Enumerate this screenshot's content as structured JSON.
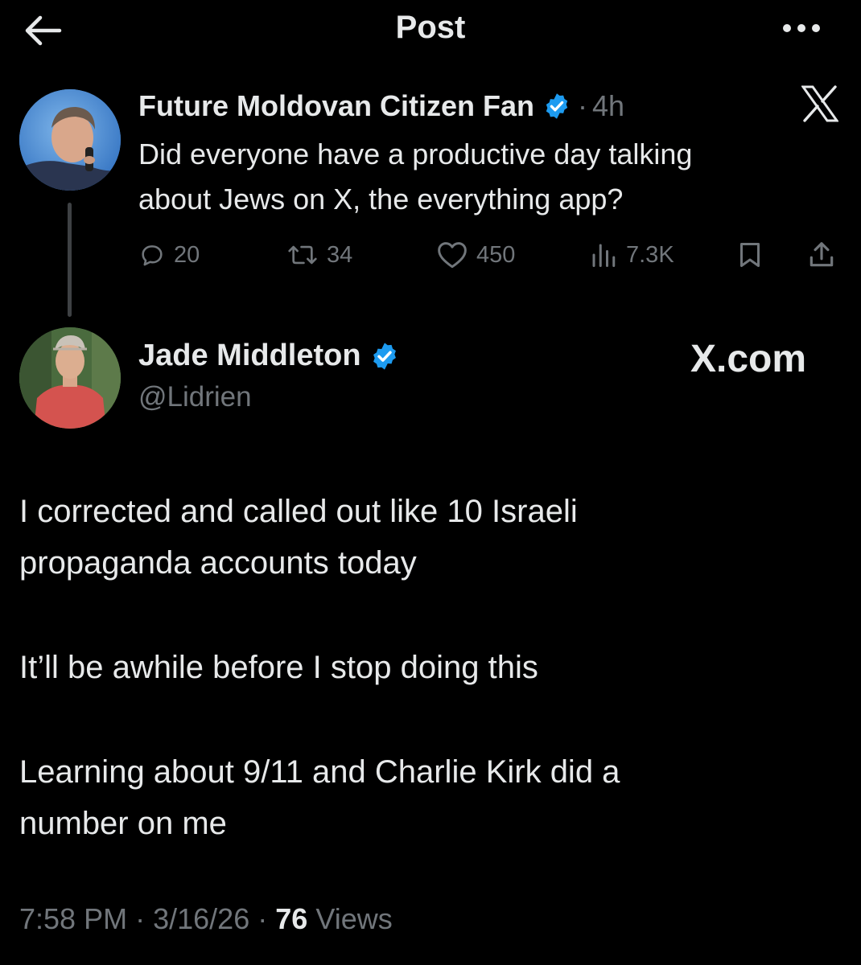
{
  "header": {
    "title": "Post",
    "back_icon": "arrow-left-icon",
    "more_icon": "more-horizontal-icon"
  },
  "quoted_post": {
    "author_name": "Future Moldovan Citizen Fan",
    "separator": "·",
    "time": "4h",
    "text_line_1": "Did everyone have a productive day talking",
    "text_line_2": "about Jews on X, the everything app?",
    "actions": {
      "replies": "20",
      "reposts": "34",
      "likes": "450",
      "views": "7.3K"
    }
  },
  "main_post": {
    "author_name": "Jade Middleton",
    "handle": "@Lidrien",
    "watermark": "X.com",
    "paragraphs": [
      "I corrected and called out like 10 Israeli",
      "propaganda accounts today",
      "It’ll be awhile before I stop doing this",
      "Learning about 9/11 and Charlie Kirk did a",
      "number on me"
    ],
    "time": "7:58 PM",
    "date": "3/16/26",
    "meta_sep": "·",
    "views_count": "76",
    "views_label": "Views"
  },
  "colors": {
    "background": "#000000",
    "text": "#e7e9ea",
    "muted": "#71767b",
    "verified": "#1d9bf0"
  }
}
